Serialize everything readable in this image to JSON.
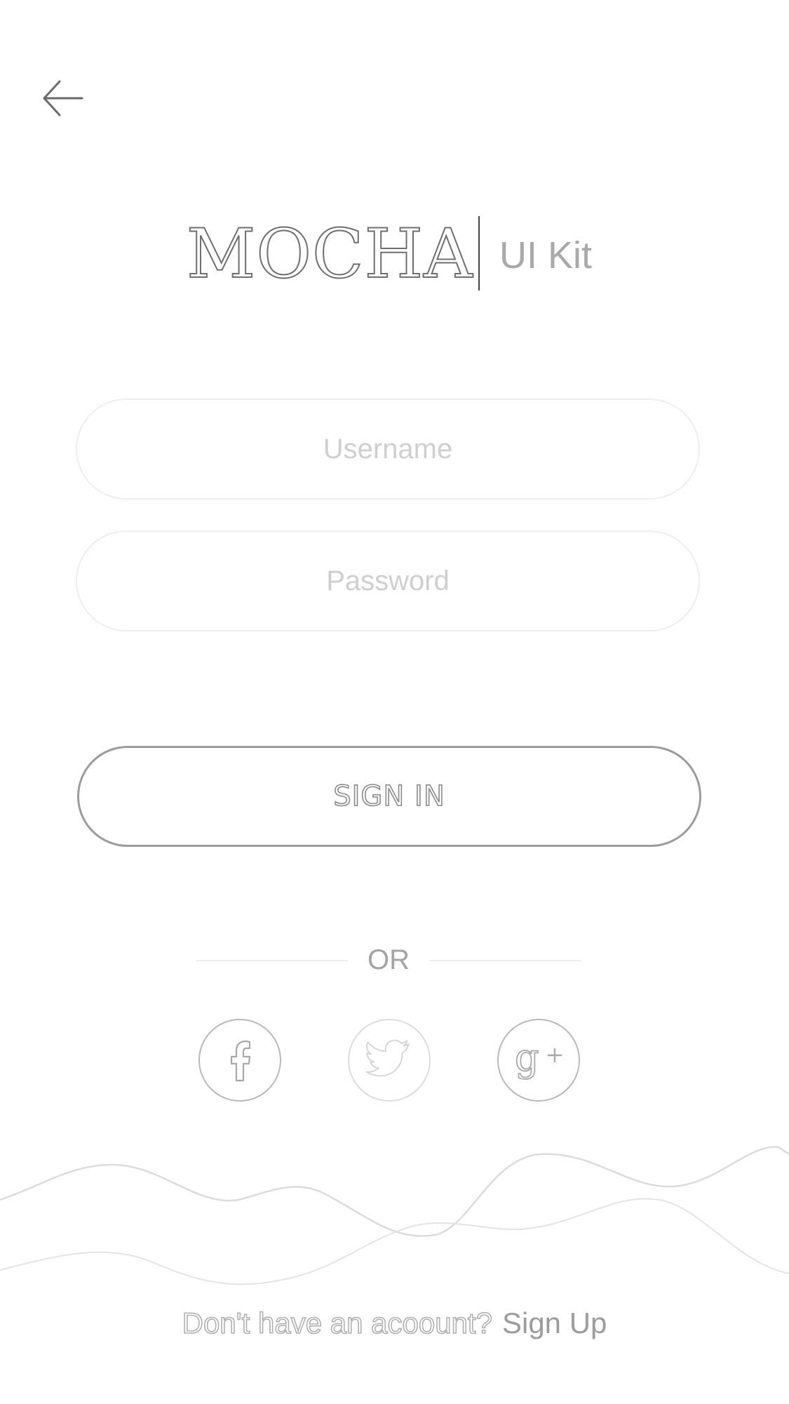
{
  "header": {
    "back_icon": "arrow-left-icon"
  },
  "logo": {
    "wordmark": "MOCHA",
    "subtitle": "UI Kit"
  },
  "form": {
    "username_placeholder": "Username",
    "username_value": "",
    "password_placeholder": "Password",
    "password_value": "",
    "signin_label": "SIGN IN"
  },
  "divider": {
    "label": "OR"
  },
  "social": {
    "icons": [
      "facebook-icon",
      "twitter-icon",
      "google-plus-icon"
    ]
  },
  "footer": {
    "prompt": "Don't have an acoount?",
    "link": "Sign Up"
  },
  "colors": {
    "background": "#ffffff",
    "outline": "#9c9c9c",
    "muted": "#cfcfcf"
  }
}
